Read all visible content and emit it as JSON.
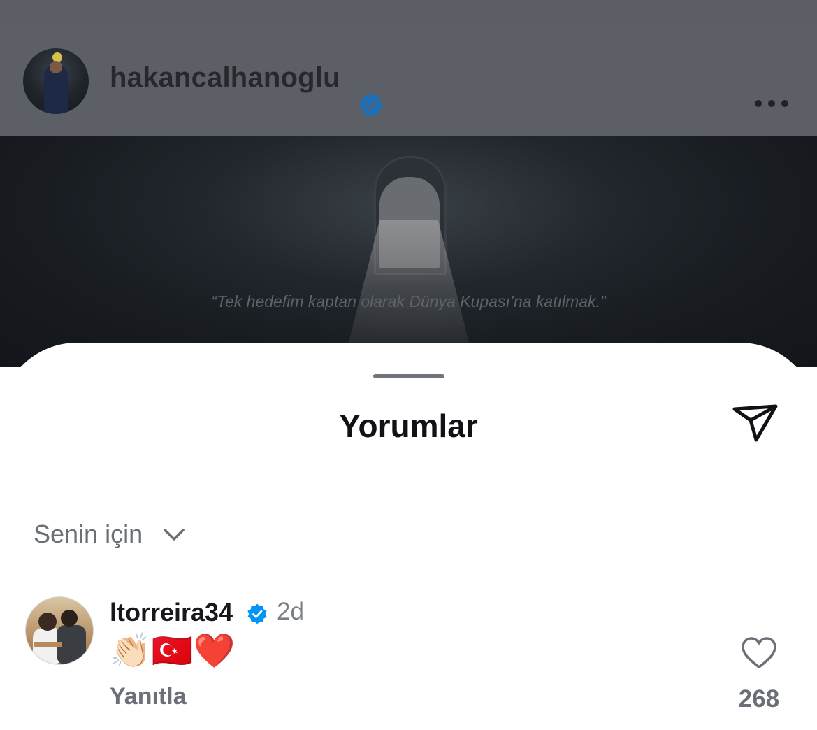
{
  "post": {
    "username": "hakancalhanoglu",
    "verified": true,
    "avatar_icon": "profile-photo",
    "more_icon": "more-horizontal-icon",
    "image_quote": "“Tek hedefim kaptan olarak Dünya Kupası’na katılmak.”"
  },
  "sheet": {
    "title": "Yorumlar",
    "send_icon": "paper-plane-icon",
    "sort_label": "Senin için",
    "sort_icon": "chevron-down-icon"
  },
  "comments": [
    {
      "username": "ltorreira34",
      "verified": true,
      "time": "2d",
      "text": "👏🏻🇹🇷❤️",
      "reply_label": "Yanıtla",
      "likes": "268",
      "like_icon": "heart-outline-icon"
    }
  ],
  "colors": {
    "verified_blue": "#0095f6",
    "overlay": "#5c6066",
    "title_text": "#101215",
    "secondary_text": "#6b7078"
  }
}
